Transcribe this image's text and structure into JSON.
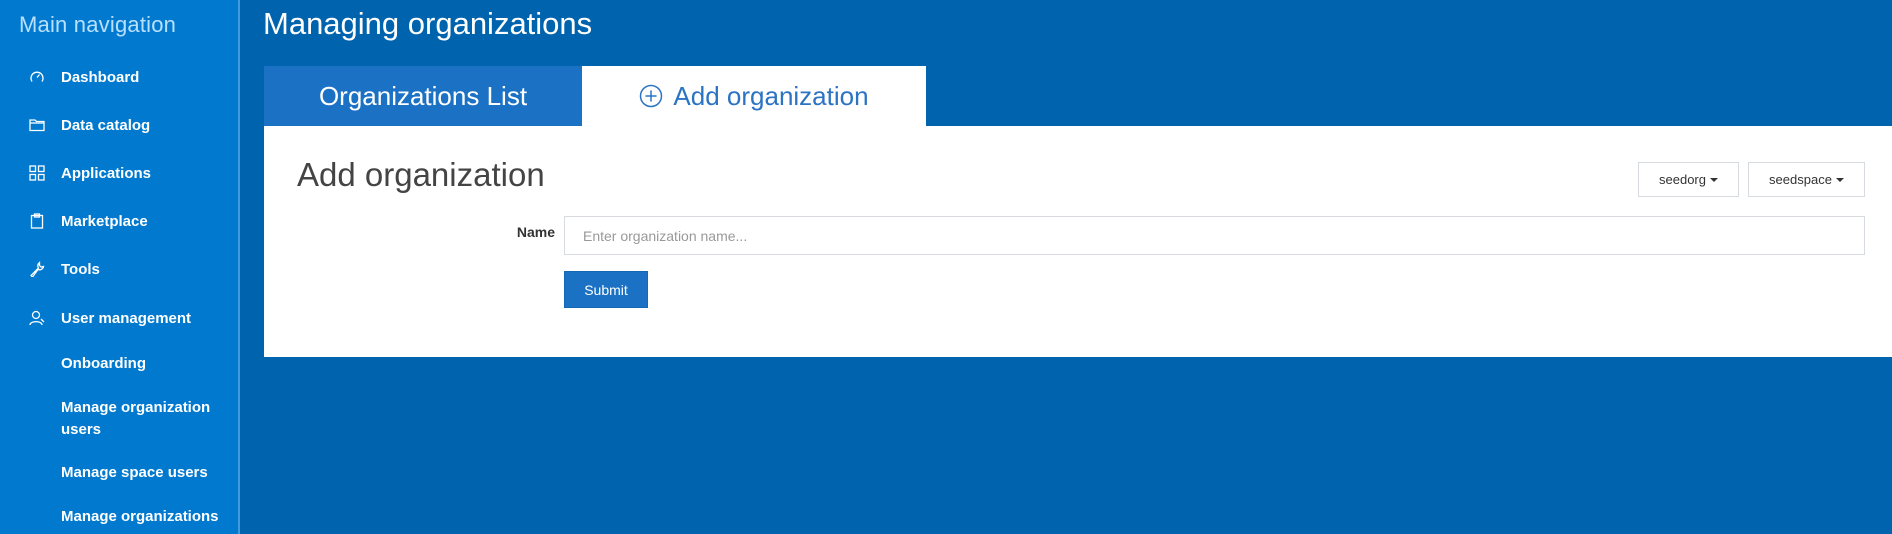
{
  "sidebar": {
    "title": "Main navigation",
    "items": [
      {
        "label": "Dashboard",
        "icon": "speedometer-icon"
      },
      {
        "label": "Data catalog",
        "icon": "folder-icon"
      },
      {
        "label": "Applications",
        "icon": "grid-icon"
      },
      {
        "label": "Marketplace",
        "icon": "clipboard-icon"
      },
      {
        "label": "Tools",
        "icon": "wrench-icon"
      },
      {
        "label": "User management",
        "icon": "user-icon"
      }
    ],
    "subitems": [
      {
        "label": "Onboarding"
      },
      {
        "label": "Manage organization users"
      },
      {
        "label": "Manage space users"
      },
      {
        "label": "Manage organizations"
      }
    ]
  },
  "main": {
    "page_title": "Managing organizations",
    "tabs": [
      {
        "label": "Organizations List"
      },
      {
        "label": "Add organization",
        "icon": "plus-circle-icon",
        "active": true
      }
    ],
    "panel": {
      "title": "Add organization",
      "org_dropdown": "seedorg",
      "space_dropdown": "seedspace",
      "name_label": "Name",
      "name_value": "",
      "name_placeholder": "Enter organization name...",
      "submit_label": "Submit"
    }
  },
  "colors": {
    "background": "#0063ae",
    "sidebar": "#0079cf",
    "accent": "#1b72c5"
  }
}
